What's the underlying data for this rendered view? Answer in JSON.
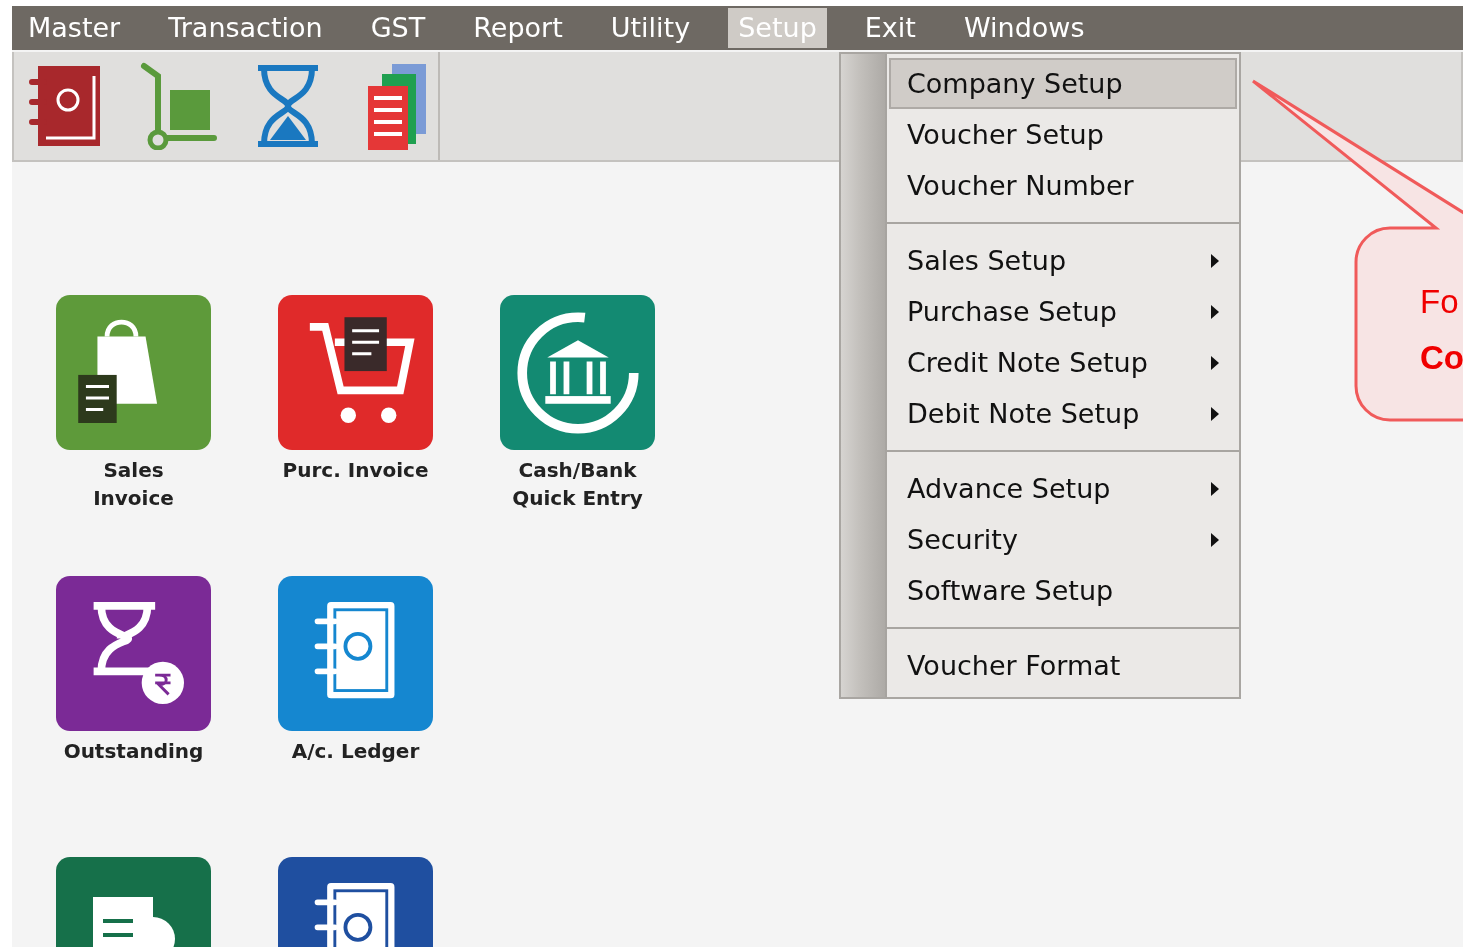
{
  "menu_bar": [
    {
      "label": "Master",
      "selected": false
    },
    {
      "label": "Transaction",
      "selected": false
    },
    {
      "label": "GST",
      "selected": false
    },
    {
      "label": "Report",
      "selected": false
    },
    {
      "label": "Utility",
      "selected": false
    },
    {
      "label": "Setup",
      "selected": true
    },
    {
      "label": "Exit",
      "selected": false
    },
    {
      "label": "Windows",
      "selected": false
    }
  ],
  "toolbar": [
    {
      "kind": "address-book"
    },
    {
      "kind": "trolley"
    },
    {
      "kind": "hourglass"
    },
    {
      "kind": "documents"
    }
  ],
  "setup_menu": [
    {
      "items": [
        {
          "label": "Company Setup",
          "submenu": false,
          "selected": true
        },
        {
          "label": "Voucher Setup",
          "submenu": false,
          "selected": false
        },
        {
          "label": "Voucher Number",
          "submenu": false,
          "selected": false
        }
      ]
    },
    {
      "items": [
        {
          "label": "Sales Setup",
          "submenu": true,
          "selected": false
        },
        {
          "label": "Purchase Setup",
          "submenu": true,
          "selected": false
        },
        {
          "label": "Credit Note Setup",
          "submenu": true,
          "selected": false
        },
        {
          "label": "Debit Note Setup",
          "submenu": true,
          "selected": false
        }
      ]
    },
    {
      "items": [
        {
          "label": "Advance Setup",
          "submenu": true,
          "selected": false
        },
        {
          "label": "Security",
          "submenu": true,
          "selected": false
        },
        {
          "label": "Software Setup",
          "submenu": false,
          "selected": false
        }
      ]
    },
    {
      "items": [
        {
          "label": "Voucher Format",
          "submenu": false,
          "selected": false
        }
      ]
    }
  ],
  "shortcuts": [
    {
      "kind": "bag",
      "label": "Sales\nInvoice",
      "color": "#5e9a3a"
    },
    {
      "kind": "cart",
      "label": "Purc. Invoice",
      "color": "#e02a2a"
    },
    {
      "kind": "bank",
      "label": "Cash/Bank\nQuick Entry",
      "color": "#138a72"
    },
    {
      "kind": "hourglass",
      "label": "Outstanding",
      "color": "#7b2a96"
    },
    {
      "kind": "ledger",
      "label": "A/c. Ledger",
      "color": "#1587d0"
    },
    {
      "kind": "report",
      "color": "#16704a"
    },
    {
      "kind": "ledger",
      "color": "#1f4fa0"
    }
  ],
  "callout": {
    "line_1": "Fo",
    "line_2": "Co"
  }
}
